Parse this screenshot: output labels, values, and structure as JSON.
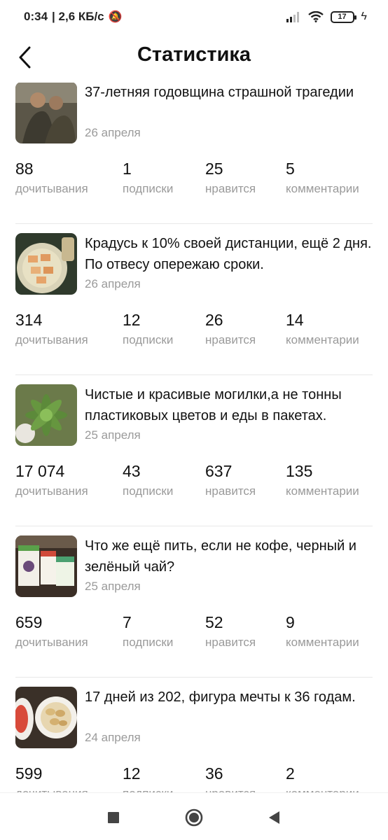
{
  "status_bar": {
    "time": "0:34",
    "speed": "| 2,6 КБ/с",
    "battery": "17"
  },
  "header": {
    "title": "Статистика"
  },
  "stat_labels": {
    "reads": "дочитывания",
    "subs": "подписки",
    "likes": "нравится",
    "comments": "комментарии"
  },
  "cards": [
    {
      "title": "37-летняя годовщина страшной трагедии",
      "date": "26 апреля",
      "reads": "88",
      "subs": "1",
      "likes": "25",
      "comments": "5",
      "thumb_icon": "soldiers-photo-thumbnail"
    },
    {
      "title": "Крадусь к 10% своей дистанции, ещё 2 дня. По отвесу опережаю сроки.",
      "date": "26 апреля",
      "reads": "314",
      "subs": "12",
      "likes": "26",
      "comments": "14",
      "thumb_icon": "food-plate-thumbnail"
    },
    {
      "title": "Чистые и красивые могилки,а не тонны пластиковых цветов и еды в пакетах.",
      "date": "25 апреля",
      "reads": "17 074",
      "subs": "43",
      "likes": "637",
      "comments": "135",
      "thumb_icon": "succulent-plant-thumbnail"
    },
    {
      "title": "Что же ещё пить, если не кофе, черный и зелёный чай?",
      "date": "25 апреля",
      "reads": "659",
      "subs": "7",
      "likes": "52",
      "comments": "9",
      "thumb_icon": "tea-packages-thumbnail"
    },
    {
      "title": "17 дней из 202, фигура мечты к 36 годам.",
      "date": "24 апреля",
      "reads": "599",
      "subs": "12",
      "likes": "36",
      "comments": "2",
      "thumb_icon": "fruit-plate-thumbnail"
    }
  ]
}
